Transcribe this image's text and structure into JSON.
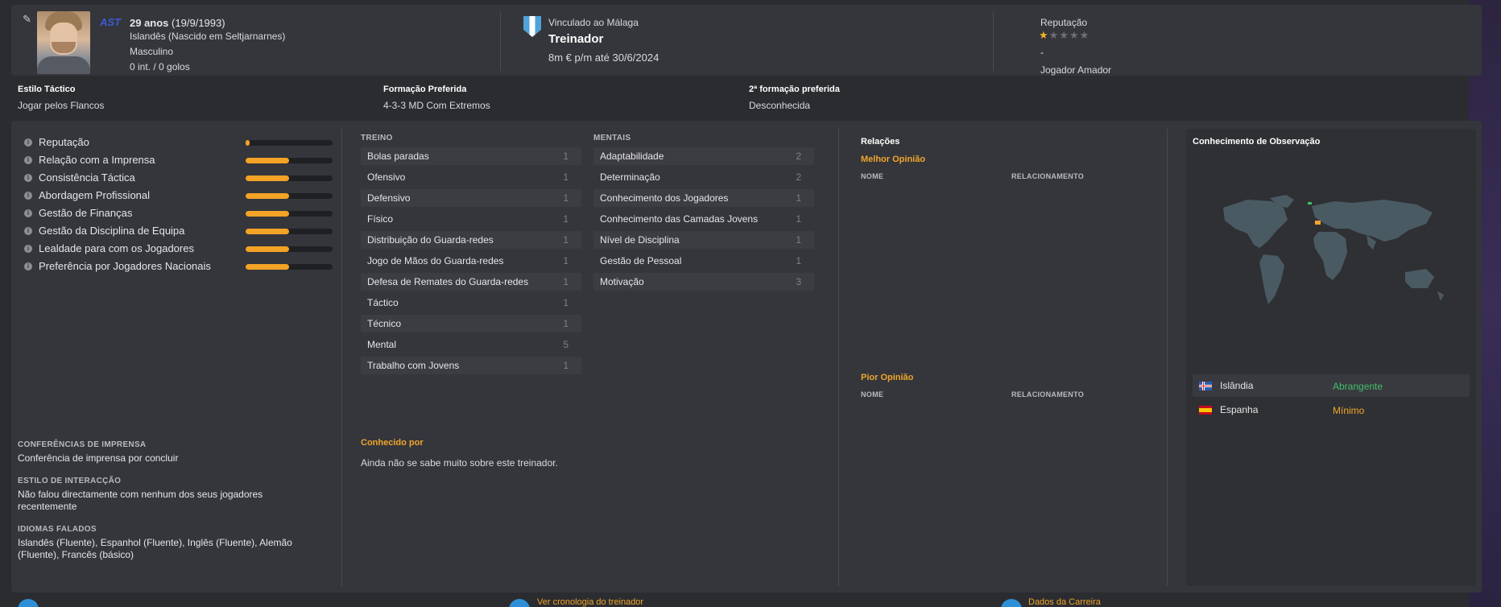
{
  "header": {
    "club_mini": "AST",
    "age_line": {
      "age": "29 anos",
      "dob": "(19/9/1993)"
    },
    "nationality": "Islandês (Nascido em Seltjarnarnes)",
    "gender": "Masculino",
    "caps": "0 int. / 0 golos",
    "club_label": "Vinculado ao Málaga",
    "role": "Treinador",
    "contract": "8m € p/m até 30/6/2024",
    "reputation_label": "Reputação",
    "reputation_stars": 0.5,
    "reputation_stars_max": 5,
    "reputation_dash": "-",
    "reputation_level": "Jogador Amador"
  },
  "tactics": {
    "style_label": "Estilo Táctico",
    "style_value": "Jogar pelos Flancos",
    "formation_label": "Formação Preferida",
    "formation_value": "4-3-3 MD Com Extremos",
    "second_label": "2ª formação preferida",
    "second_value": "Desconhecida"
  },
  "attributes": [
    {
      "name": "Reputação",
      "level": 0.05
    },
    {
      "name": "Relação com a Imprensa",
      "level": 0.5
    },
    {
      "name": "Consistência Táctica",
      "level": 0.5
    },
    {
      "name": "Abordagem Profissional",
      "level": 0.5
    },
    {
      "name": "Gestão de Finanças",
      "level": 0.5
    },
    {
      "name": "Gestão da Disciplina de Equipa",
      "level": 0.5
    },
    {
      "name": "Lealdade para com os Jogadores",
      "level": 0.5
    },
    {
      "name": "Preferência por Jogadores Nacionais",
      "level": 0.5
    }
  ],
  "info_sections": {
    "press_label": "CONFERÊNCIAS DE IMPRENSA",
    "press_value": "Conferência de imprensa por concluir",
    "interaction_label": "ESTILO DE INTERACÇÃO",
    "interaction_value": "Não falou directamente com nenhum dos seus jogadores recentemente",
    "languages_label": "IDIOMAS FALADOS",
    "languages_value": "Islandês (Fluente), Espanhol (Fluente), Inglês (Fluente), Alemão (Fluente), Francês (básico)"
  },
  "training": {
    "title": "TREINO",
    "rows": [
      {
        "name": "Bolas paradas",
        "value": "1"
      },
      {
        "name": "Ofensivo",
        "value": "1"
      },
      {
        "name": "Defensivo",
        "value": "1"
      },
      {
        "name": "Físico",
        "value": "1"
      },
      {
        "name": "Distribuição do Guarda-redes",
        "value": "1"
      },
      {
        "name": "Jogo de Mãos do Guarda-redes",
        "value": "1"
      },
      {
        "name": "Defesa de Remates do Guarda-redes",
        "value": "1"
      },
      {
        "name": "Táctico",
        "value": "1"
      },
      {
        "name": "Técnico",
        "value": "1"
      },
      {
        "name": "Mental",
        "value": "5"
      },
      {
        "name": "Trabalho com Jovens",
        "value": "1"
      }
    ]
  },
  "mental": {
    "title": "MENTAIS",
    "rows": [
      {
        "name": "Adaptabilidade",
        "value": "2"
      },
      {
        "name": "Determinação",
        "value": "2"
      },
      {
        "name": "Conhecimento dos Jogadores",
        "value": "1"
      },
      {
        "name": "Conhecimento das Camadas Jovens",
        "value": "1"
      },
      {
        "name": "Nível de Disciplina",
        "value": "1"
      },
      {
        "name": "Gestão de Pessoal",
        "value": "1"
      },
      {
        "name": "Motivação",
        "value": "3"
      }
    ]
  },
  "known": {
    "label": "Conhecido por",
    "value": "Ainda não se sabe muito sobre este treinador."
  },
  "relations": {
    "title": "Relações",
    "best_label": "Melhor Opinião",
    "worst_label": "Pior Opinião",
    "col_name": "NOME",
    "col_relation": "RELACIONAMENTO"
  },
  "scouting": {
    "title": "Conhecimento de Observação",
    "countries": [
      {
        "name": "Islândia",
        "level": "Abrangente",
        "color": "#3fbf6a",
        "flag": "iceland-flag"
      },
      {
        "name": "Espanha",
        "level": "Mínimo",
        "color": "#f0a52b",
        "flag": "spain-flag"
      }
    ]
  },
  "footer": {
    "link2": "Ver cronologia do treinador",
    "link3": "Dados da Carreira"
  },
  "colors": {
    "accent": "#f0a52b",
    "bar": "#f3a325",
    "panel": "#35363b",
    "background": "#2b2c30"
  }
}
